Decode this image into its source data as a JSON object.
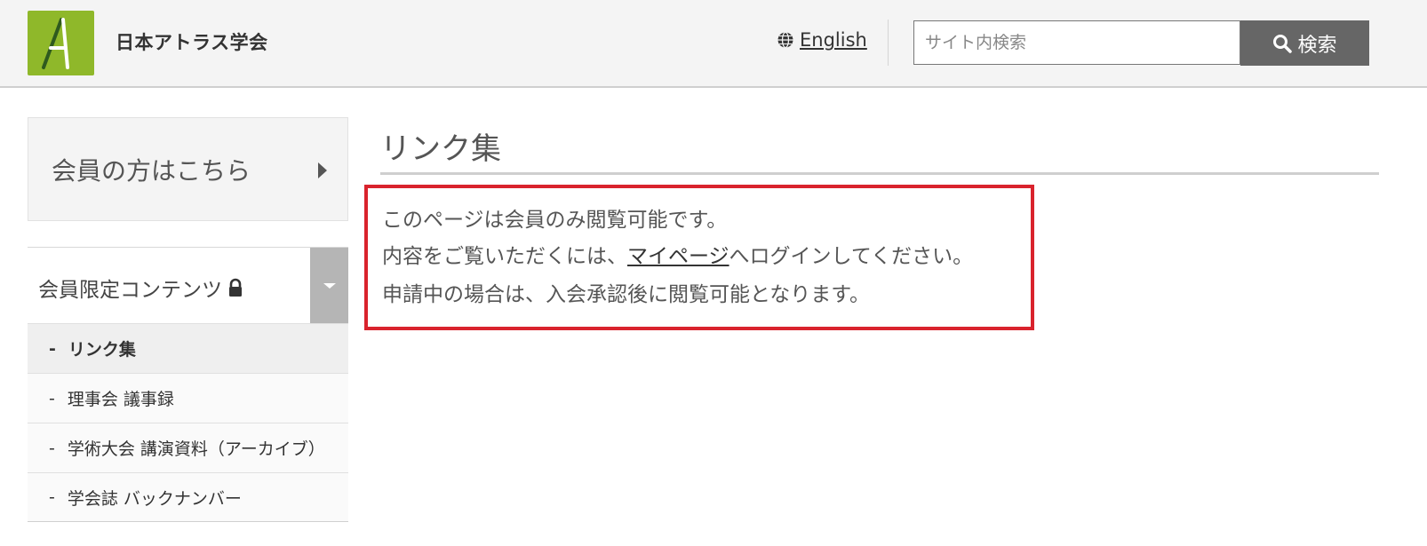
{
  "header": {
    "site_title": "日本アトラス学会",
    "logo_letter": "A",
    "lang_label": "English",
    "search": {
      "placeholder": "サイト内検索",
      "value": "",
      "button_label": "検索"
    }
  },
  "sidebar": {
    "member_box_label": "会員の方はこちら",
    "menu_head": "会員限定コンテンツ",
    "items": [
      {
        "label": "リンク集",
        "active": true
      },
      {
        "label": "理事会 議事録",
        "active": false
      },
      {
        "label": "学術大会 講演資料（アーカイブ）",
        "active": false
      },
      {
        "label": "学会誌 バックナンバー",
        "active": false
      }
    ],
    "dash": "-"
  },
  "main": {
    "title": "リンク集",
    "notice": {
      "line1": "このページは会員のみ閲覧可能です。",
      "line2_prefix": "内容をご覧いただくには、",
      "line2_link": "マイページ",
      "line2_suffix": "へログインしてください。",
      "line3": "申請中の場合は、入会承認後に閲覧可能となります。"
    }
  },
  "colors": {
    "logo_green": "#8fb82a",
    "notice_border": "#d9232d",
    "search_button": "#666666"
  }
}
